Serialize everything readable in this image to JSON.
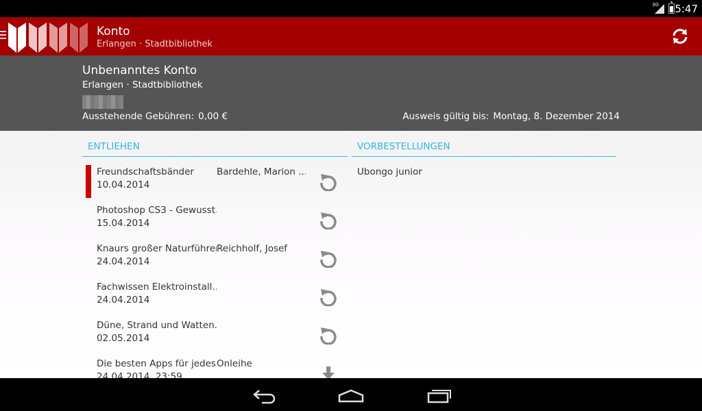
{
  "status_bar": {
    "time": "5:47",
    "network": "3G"
  },
  "app_bar": {
    "title": "Konto",
    "subtitle": "Erlangen · Stadtbibliothek",
    "color": "#a30000"
  },
  "account": {
    "name": "Unbenanntes Konto",
    "library": "Erlangen · Stadtbibliothek",
    "fees_label": "Ausstehende Gebühren:",
    "fees_value": "0,00 €",
    "valid_label": "Ausweis gültig bis:",
    "valid_value": "Montag, 8. Dezember 2014"
  },
  "lent": {
    "heading": "ENTLIEHEN",
    "items": [
      {
        "title": "Freundschaftsbänder",
        "author": "Bardehle, Marion ...",
        "date": "10.04.2014",
        "flagged": true,
        "action_icon": "renew-icon"
      },
      {
        "title": "Photoshop CS3 - Gewusst...",
        "author": "",
        "date": "15.04.2014",
        "flagged": false,
        "action_icon": "renew-icon"
      },
      {
        "title": "Knaurs großer Naturführer",
        "author": "Reichholf, Josef",
        "date": "24.04.2014",
        "flagged": false,
        "action_icon": "renew-icon"
      },
      {
        "title": "Fachwissen Elektroinstall...",
        "author": "",
        "date": "24.04.2014",
        "flagged": false,
        "action_icon": "renew-icon"
      },
      {
        "title": "Düne, Strand und Watten...",
        "author": "",
        "date": "02.05.2014",
        "flagged": false,
        "action_icon": "renew-icon"
      },
      {
        "title": "Die besten Apps für jedes ...",
        "author": "Onleihe",
        "date": "24.04.2014, 23:59",
        "flagged": false,
        "action_icon": "download-icon"
      }
    ]
  },
  "reservations": {
    "heading": "VORBESTELLUNGEN",
    "items": [
      {
        "title": "Ubongo junior"
      }
    ]
  },
  "colors": {
    "accent": "#33b5e5",
    "flag": "#cc0000"
  }
}
